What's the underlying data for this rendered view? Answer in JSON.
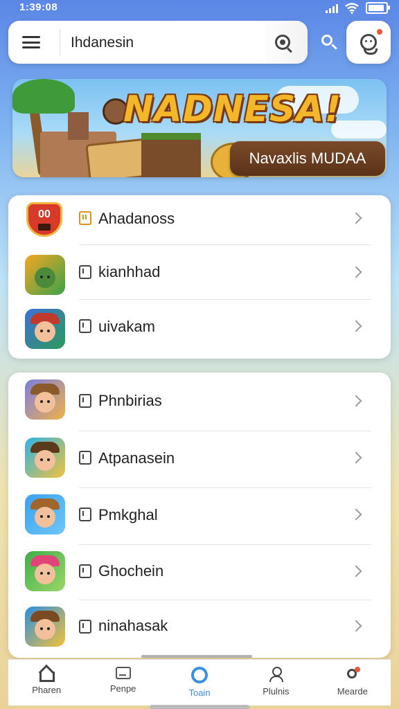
{
  "status_bar": {
    "time": "1:39:08"
  },
  "search": {
    "value": "Ihdanesin"
  },
  "banner": {
    "title": "NADNESA!",
    "cta": "Navaxlis MUDAA"
  },
  "list_group_1": [
    {
      "label": "Ahadanoss",
      "icon": "shield-icon"
    },
    {
      "label": "kianhhad",
      "icon": "warrior-icon"
    },
    {
      "label": "uivakam",
      "icon": "adventurer-icon"
    }
  ],
  "list_group_2": [
    {
      "label": "Phnbirias"
    },
    {
      "label": "Atpanasein"
    },
    {
      "label": "Pmkghal"
    },
    {
      "label": "Ghochein"
    },
    {
      "label": "ninahasak"
    }
  ],
  "bottom_nav": [
    {
      "label": "Pharen",
      "icon": "home-icon"
    },
    {
      "label": "Penpe",
      "icon": "image-icon"
    },
    {
      "label": "Toain",
      "icon": "circle-icon",
      "active": true
    },
    {
      "label": "Plulnis",
      "icon": "person-icon"
    },
    {
      "label": "Mearde",
      "icon": "profile-icon"
    }
  ],
  "colors": {
    "accent": "#3a8fe0",
    "cta_bg": "#5a3218",
    "title": "#f5b72a",
    "notification": "#e8553d"
  }
}
